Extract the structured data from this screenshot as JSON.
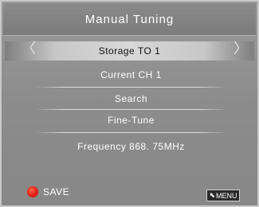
{
  "header": {
    "title": "Manual Tuning"
  },
  "rows": [
    {
      "label": "Storage TO 1"
    },
    {
      "label": "Current CH 1"
    },
    {
      "label": "Search"
    },
    {
      "label": "Fine-Tune"
    },
    {
      "label": "Frequency 868. 75MHz"
    }
  ],
  "arrows": {
    "left": "〈",
    "right": "〉"
  },
  "footer": {
    "save_label": "SAVE",
    "menu_label": "MENU",
    "back_glyph": "⬉"
  }
}
